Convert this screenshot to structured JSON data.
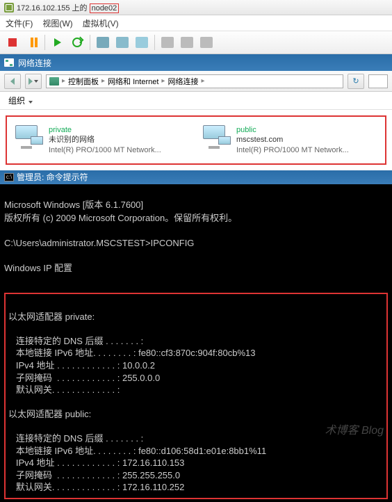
{
  "window": {
    "title_prefix": "172.16.102.155 上的 ",
    "title_node": "node02"
  },
  "menu": {
    "file": "文件(F)",
    "view": "视图(W)",
    "vm": "虚拟机(V)"
  },
  "nc": {
    "title": "网络连接"
  },
  "breadcrumb": {
    "cp": "控制面板",
    "ni": "网络和 Internet",
    "nc": "网络连接"
  },
  "org": {
    "label": "组织"
  },
  "connections": [
    {
      "name": "private",
      "status": "未识别的网络",
      "adapter": "Intel(R) PRO/1000 MT Network..."
    },
    {
      "name": "public",
      "status": "mscstest.com",
      "adapter": "Intel(R) PRO/1000 MT Network..."
    }
  ],
  "cmd": {
    "title": "管理员: 命令提示符"
  },
  "console": {
    "ver": "Microsoft Windows [版本 6.1.7600]",
    "copy": "版权所有 (c) 2009 Microsoft Corporation。保留所有权利。",
    "prompt": "C:\\Users\\administrator.MSCSTEST>IPCONFIG",
    "ipcfg": "Windows IP 配置",
    "adapters": [
      {
        "title": "以太网适配器 private:",
        "lines": [
          "   连接特定的 DNS 后缀 . . . . . . . :",
          "   本地链接 IPv6 地址. . . . . . . . : fe80::cf3:870c:904f:80cb%13",
          "   IPv4 地址 . . . . . . . . . . . . : 10.0.0.2",
          "   子网掩码  . . . . . . . . . . . . : 255.0.0.0",
          "   默认网关. . . . . . . . . . . . . :"
        ]
      },
      {
        "title": "以太网适配器 public:",
        "lines": [
          "   连接特定的 DNS 后缀 . . . . . . . :",
          "   本地链接 IPv6 地址. . . . . . . . : fe80::d106:58d1:e01e:8bb1%11",
          "   IPv4 地址 . . . . . . . . . . . . : 172.16.110.153",
          "   子网掩码  . . . . . . . . . . . . : 255.255.255.0",
          "   默认网关. . . . . . . . . . . . . : 172.16.110.252"
        ]
      }
    ]
  },
  "watermark": "术博客 Blog"
}
